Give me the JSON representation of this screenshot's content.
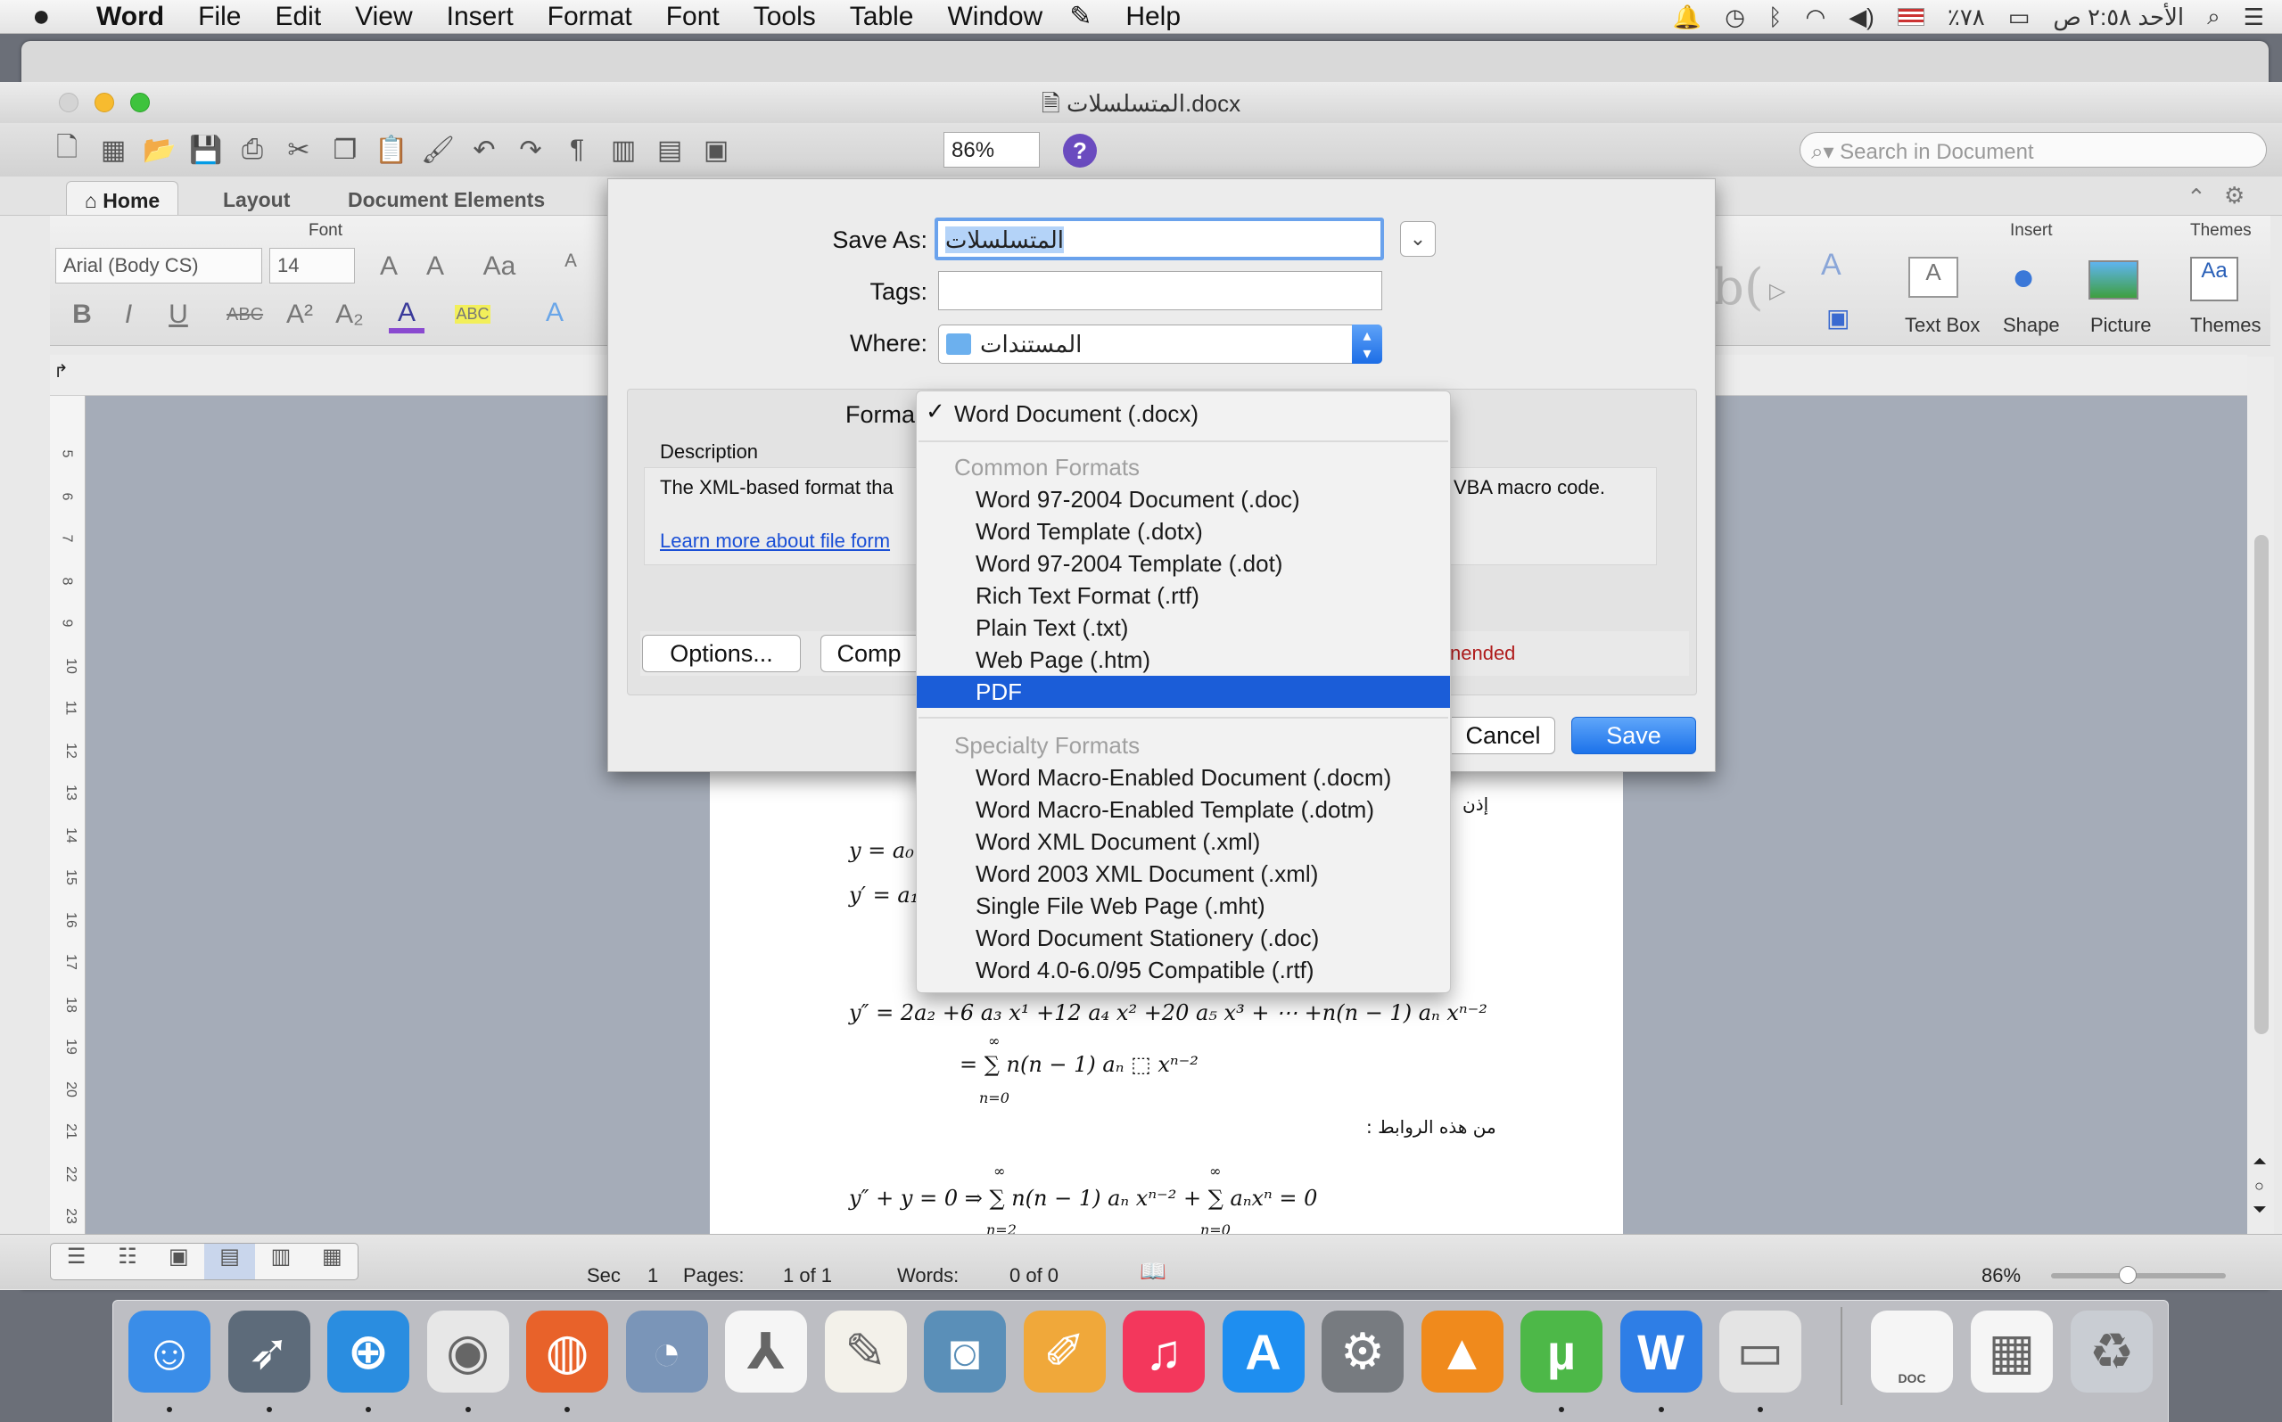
{
  "menubar": {
    "apple": "",
    "app": "Word",
    "items": [
      "File",
      "Edit",
      "View",
      "Insert",
      "Format",
      "Font",
      "Tools",
      "Table",
      "Window",
      "Help"
    ],
    "clock": "الأحد ٢:٥٨ ص",
    "battery": "٪٧٨"
  },
  "window": {
    "title": "المتسلسلات.docx",
    "zoom": "86%",
    "search_placeholder": "Search in Document"
  },
  "ribbon": {
    "tabs": [
      "Home",
      "Layout",
      "Document Elements"
    ],
    "group_font": "Font",
    "font_name": "Arial (Body CS)",
    "font_size": "14",
    "group_insert": "Insert",
    "group_themes": "Themes",
    "insert_items": [
      "Text Box",
      "Shape",
      "Picture"
    ],
    "themes_item": "Themes"
  },
  "ruler": [
    "5",
    "6",
    "7",
    "8",
    "9",
    "10",
    "11",
    "12",
    "13",
    "14",
    "15",
    "16",
    "17",
    "18",
    "19",
    "20",
    "21",
    "22",
    "23"
  ],
  "document": {
    "arabic_1": "إذن",
    "eq1": "y = a₀",
    "eq2": "y′ = a₁",
    "eq3": "y″ = 2a₂ +6 a₃ x¹ +12 a₄ x² +20 a₅ x³ + ⋯ +n(n − 1) aₙ xⁿ⁻²",
    "eq4": "= ∑ n(n − 1) aₙ ⬚ xⁿ⁻²",
    "eq4_sub": "n=0",
    "arabic_2": "من هذه الروابط :",
    "eq5": "y″ + y = 0  ⇒ ∑ n(n − 1) aₙ xⁿ⁻² + ∑ aₙxⁿ = 0",
    "eq5_sub1": "n=2",
    "eq5_sub2": "n=0",
    "infinity": "∞"
  },
  "statusbar": {
    "sec_label": "Sec",
    "sec_value": "1",
    "pages_label": "Pages:",
    "pages_value": "1 of 1",
    "words_label": "Words:",
    "words_value": "0 of 0",
    "zoom": "86%"
  },
  "dialog": {
    "save_as_label": "Save As:",
    "save_as_value": "المتسلسلات",
    "tags_label": "Tags:",
    "tags_value": "",
    "where_label": "Where:",
    "where_value": "المستندات",
    "format_label": "Forma",
    "description_label": "Description",
    "description_left": "The XML-based format tha",
    "description_right": "VBA macro code.",
    "learn_more": "Learn more about file form",
    "options_button": "Options...",
    "compat_button": "Comp",
    "recommended_partial": "nended",
    "cancel_button": "Cancel",
    "save_button": "Save"
  },
  "format_menu": {
    "checkmark": "✓",
    "current": "Word Document (.docx)",
    "common_header": "Common Formats",
    "common": [
      "Word 97-2004 Document (.doc)",
      "Word Template (.dotx)",
      "Word 97-2004 Template (.dot)",
      "Rich Text Format (.rtf)",
      "Plain Text (.txt)",
      "Web Page (.htm)",
      "PDF"
    ],
    "selected": "PDF",
    "specialty_header": "Specialty Formats",
    "specialty": [
      "Word Macro-Enabled Document (.docm)",
      "Word Macro-Enabled Template (.dotm)",
      "Word XML Document (.xml)",
      "Word 2003 XML Document (.xml)",
      "Single File Web Page (.mht)",
      "Word Document Stationery (.doc)",
      "Word 4.0-6.0/95 Compatible (.rtf)"
    ]
  },
  "dock": {
    "icons": [
      "finder-icon",
      "launchpad-icon",
      "safari-icon",
      "chrome-icon",
      "firefox-icon",
      "preview-icon",
      "calendar-icon",
      "textedit-icon",
      "iphoto-icon",
      "pages-icon",
      "itunes-icon",
      "app-store-icon",
      "system-preferences-icon",
      "vlc-icon",
      "utorrent-icon",
      "word-icon",
      "printer-icon",
      "document-stack-icon",
      "screenshot-stack-icon",
      "trash-icon"
    ],
    "doc_label": "DOC"
  },
  "colors": {
    "accent": "#1b5dd8",
    "save": "#2a7cf0",
    "link": "#1a4fd6",
    "recommended": "#b01c1c"
  }
}
